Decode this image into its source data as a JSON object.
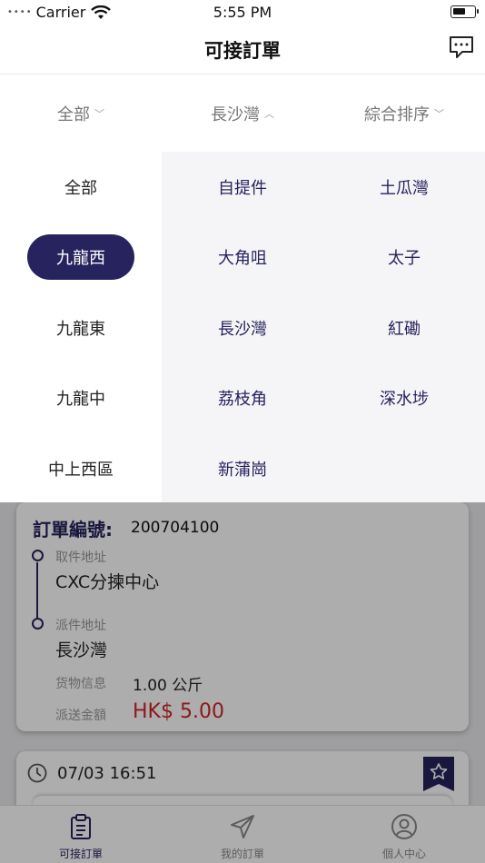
{
  "status_bar": {
    "carrier": "Carrier",
    "time": "5:55 PM"
  },
  "nav": {
    "title": "可接訂單",
    "right_icon": "message-icon"
  },
  "filters": [
    {
      "label": "全部",
      "chevron": "﹀"
    },
    {
      "label": "長沙灣",
      "chevron": "︿"
    },
    {
      "label": "綜合排序",
      "chevron": "﹀"
    }
  ],
  "regions": [
    "全部",
    "九龍西",
    "九龍東",
    "九龍中",
    "中上西區"
  ],
  "active_region": "九龍西",
  "districts": [
    "自提件",
    "土瓜灣",
    "大角咀",
    "太子",
    "長沙灣",
    "紅磡",
    "荔枝角",
    "深水埗",
    "新蒲崗"
  ],
  "order": {
    "number_label": "訂單編號:",
    "number": "200704100",
    "pickup_label": "取件地址",
    "pickup": "CXC分揀中心",
    "delivery_label": "派件地址",
    "delivery": "長沙灣",
    "cargo_label": "货物信息",
    "cargo": "1.00 公斤",
    "fee_label": "派送金額",
    "fee": "HK$ 5.00"
  },
  "order2": {
    "time": "07/03 16:51"
  },
  "tabs": [
    {
      "label": "可接訂單",
      "icon": "clipboard-icon",
      "active": true
    },
    {
      "label": "我的訂單",
      "icon": "send-icon",
      "active": false
    },
    {
      "label": "個人中心",
      "icon": "user-circle-icon",
      "active": false
    }
  ],
  "colors": {
    "primary": "#27235e",
    "price": "#d0242a",
    "panel_bg": "#f5f5f7"
  }
}
